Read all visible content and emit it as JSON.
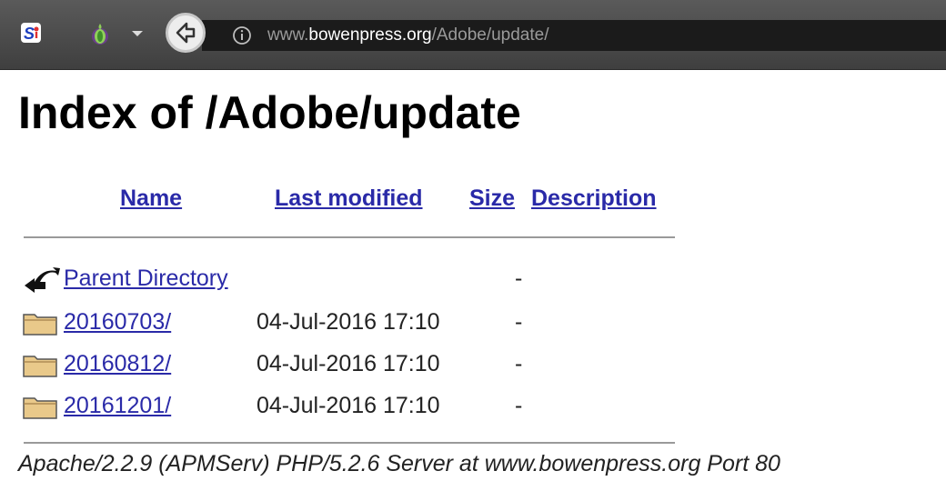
{
  "browser": {
    "url_prefix": "www.",
    "url_host": "bowenpress.org",
    "url_path": "/Adobe/update/",
    "back_label": "Back"
  },
  "page": {
    "title": "Index of /Adobe/update",
    "headers": {
      "name": "Name",
      "last_modified": "Last modified",
      "size": "Size",
      "description": "Description"
    },
    "rows": [
      {
        "icon": "parent-directory-icon",
        "name": "Parent Directory",
        "modified": "",
        "size": "-"
      },
      {
        "icon": "folder-icon",
        "name": "20160703/",
        "modified": "04-Jul-2016 17:10",
        "size": "-"
      },
      {
        "icon": "folder-icon",
        "name": "20160812/",
        "modified": "04-Jul-2016 17:10",
        "size": "-"
      },
      {
        "icon": "folder-icon",
        "name": "20161201/",
        "modified": "04-Jul-2016 17:10",
        "size": "-"
      }
    ],
    "footer": "Apache/2.2.9 (APMServ) PHP/5.2.6 Server at www.bowenpress.org Port 80"
  },
  "colors": {
    "link": "#2a2aa8",
    "toolbar": "#4a4a4a",
    "urlbar": "#1b1b1b",
    "folder": "#e9c98a"
  }
}
